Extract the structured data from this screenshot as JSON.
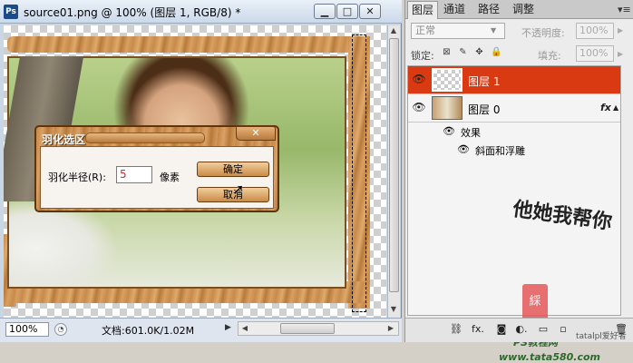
{
  "document": {
    "title": "source01.png @ 100% (图层 1, RGB/8) *",
    "app_icon": "Ps",
    "min_glyph": "▁",
    "max_glyph": "□",
    "close_glyph": "✕",
    "zoom": "100%",
    "doc_size": "文档:601.0K/1.02M",
    "status_arrow": "▶"
  },
  "dialog": {
    "title": "羽化选区",
    "close_glyph": "✕",
    "radius_label": "羽化半径(R):",
    "radius_value": "5",
    "unit": "像素",
    "ok": "确定",
    "cancel": "取消"
  },
  "layers_panel": {
    "tabs": [
      "图层",
      "通道",
      "路径",
      "调整"
    ],
    "menu_glyph": "▾≡",
    "blend_mode": "正常",
    "opacity_label": "不透明度:",
    "opacity_value": "100%",
    "lock_label": "锁定:",
    "fill_label": "填充:",
    "fill_value": "100%",
    "layers": [
      {
        "name": "图层 1",
        "selected": true
      },
      {
        "name": "图层 0",
        "selected": false,
        "fx": "fx"
      }
    ],
    "effects_label": "效果",
    "bevel_label": "斜面和浮雕",
    "eye_glyph": "👁",
    "watermark_text": {
      "calligraphy": "他她我帮你",
      "seal": "綵",
      "ps_tutorial": "PS教程网",
      "url": "www.tata580.com"
    },
    "bottom_icons": [
      "link-icon",
      "fx-icon",
      "mask-icon",
      "adjustment-icon",
      "group-icon",
      "new-layer-icon",
      "trash-icon"
    ],
    "bottom_glyphs": [
      "⛓",
      "fx.",
      "◙",
      "◐.",
      "▭",
      "▫",
      "🗑"
    ],
    "corner_watermark": "tatalpl爱好者"
  },
  "colors": {
    "selected_layer": "#d93a12",
    "wood": "#c98c4c"
  }
}
